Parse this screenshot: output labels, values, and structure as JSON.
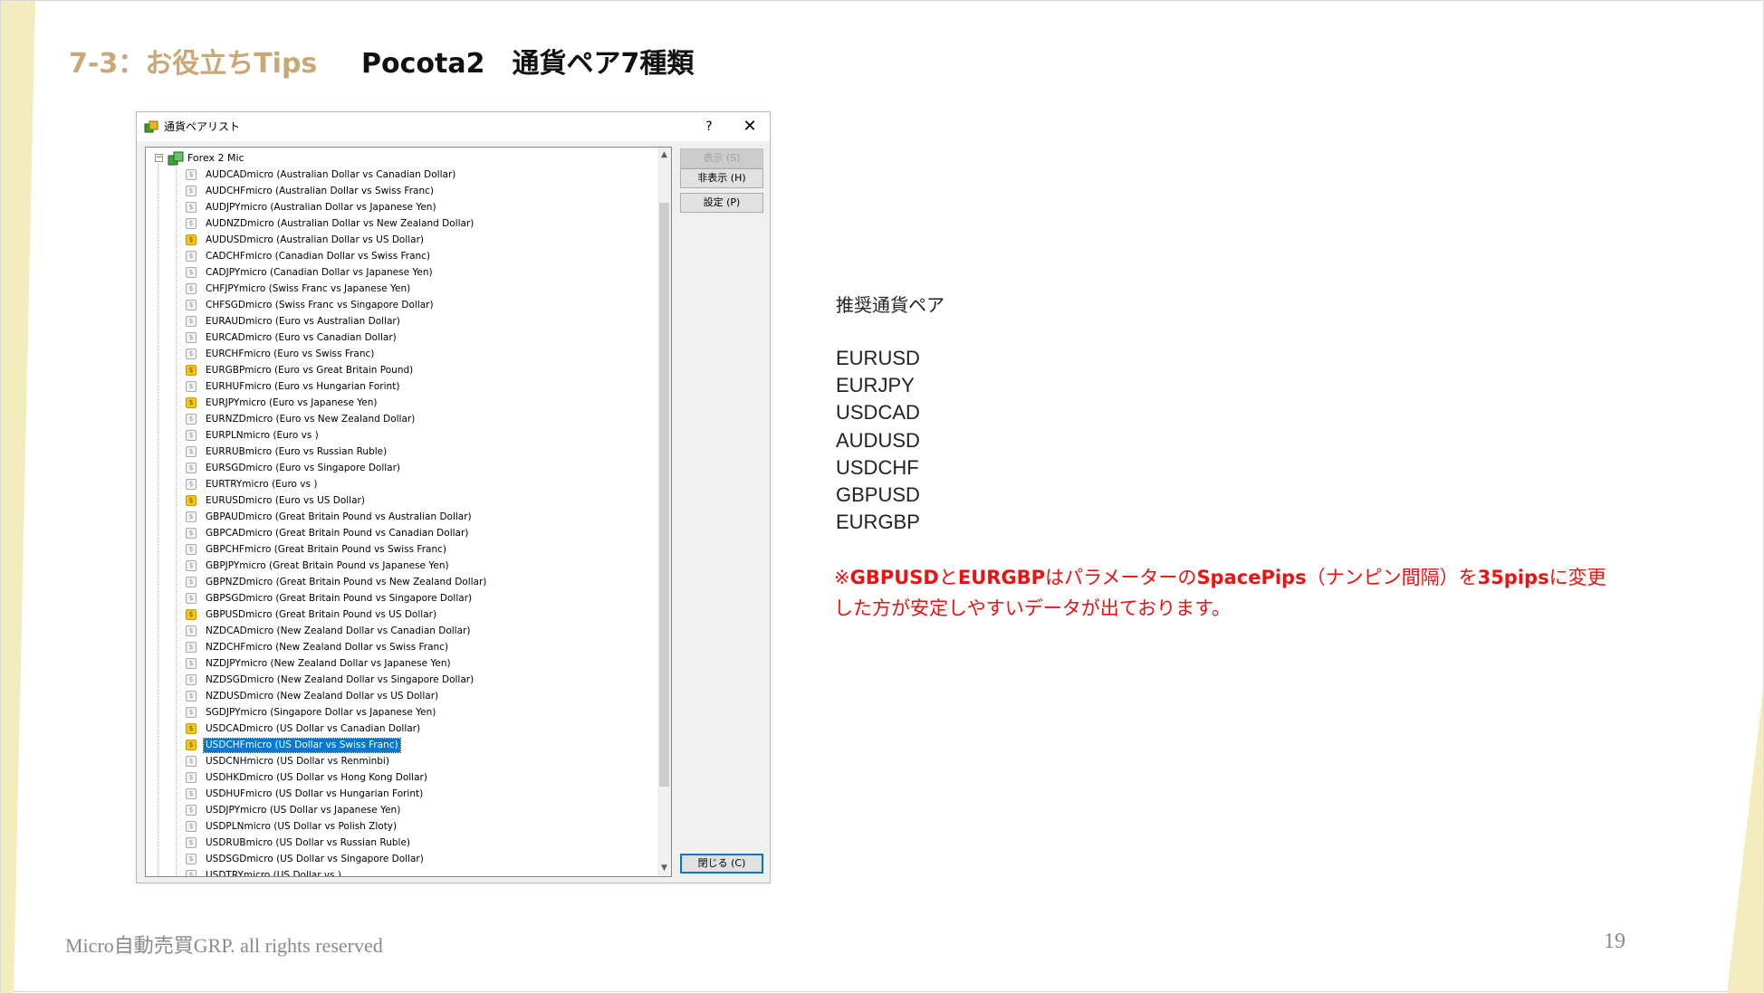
{
  "slide": {
    "section_title": "7-3：お役立ちTips",
    "main_title": "Pocota2　通貨ペア7種類",
    "footer": "Micro自動売買GRP. all rights reserved",
    "page_number": "19"
  },
  "dialog": {
    "title": "通貨ペアリスト",
    "help_label": "?",
    "close_label": "✕",
    "root_label": "Forex 2 Mic",
    "buttons": {
      "show": "表示 (S)",
      "hide": "非表示 (H)",
      "settings": "設定 (P)",
      "close": "閉じる (C)"
    },
    "items": [
      {
        "label": "AUDCADmicro  (Australian Dollar vs Canadian Dollar)",
        "active": false
      },
      {
        "label": "AUDCHFmicro  (Australian Dollar vs Swiss Franc)",
        "active": false
      },
      {
        "label": "AUDJPYmicro  (Australian Dollar vs Japanese Yen)",
        "active": false
      },
      {
        "label": "AUDNZDmicro  (Australian Dollar vs New Zealand Dollar)",
        "active": false
      },
      {
        "label": "AUDUSDmicro  (Australian Dollar vs US Dollar)",
        "active": true
      },
      {
        "label": "CADCHFmicro  (Canadian Dollar vs Swiss Franc)",
        "active": false
      },
      {
        "label": "CADJPYmicro  (Canadian Dollar vs Japanese Yen)",
        "active": false
      },
      {
        "label": "CHFJPYmicro  (Swiss Franc vs Japanese Yen)",
        "active": false
      },
      {
        "label": "CHFSGDmicro  (Swiss Franc vs Singapore Dollar)",
        "active": false
      },
      {
        "label": "EURAUDmicro  (Euro vs Australian Dollar)",
        "active": false
      },
      {
        "label": "EURCADmicro  (Euro vs Canadian Dollar)",
        "active": false
      },
      {
        "label": "EURCHFmicro  (Euro vs Swiss Franc)",
        "active": false
      },
      {
        "label": "EURGBPmicro  (Euro vs Great Britain Pound)",
        "active": true
      },
      {
        "label": "EURHUFmicro  (Euro vs Hungarian Forint)",
        "active": false
      },
      {
        "label": "EURJPYmicro  (Euro vs Japanese Yen)",
        "active": true
      },
      {
        "label": "EURNZDmicro  (Euro vs New Zealand Dollar)",
        "active": false
      },
      {
        "label": "EURPLNmicro  (Euro vs )",
        "active": false
      },
      {
        "label": "EURRUBmicro  (Euro vs Russian Ruble)",
        "active": false
      },
      {
        "label": "EURSGDmicro  (Euro vs Singapore Dollar)",
        "active": false
      },
      {
        "label": "EURTRYmicro  (Euro vs )",
        "active": false
      },
      {
        "label": "EURUSDmicro  (Euro vs US Dollar)",
        "active": true
      },
      {
        "label": "GBPAUDmicro  (Great Britain Pound vs Australian Dollar)",
        "active": false
      },
      {
        "label": "GBPCADmicro  (Great Britain Pound vs Canadian Dollar)",
        "active": false
      },
      {
        "label": "GBPCHFmicro  (Great Britain Pound vs Swiss Franc)",
        "active": false
      },
      {
        "label": "GBPJPYmicro  (Great Britain Pound vs Japanese Yen)",
        "active": false
      },
      {
        "label": "GBPNZDmicro  (Great Britain Pound vs New Zealand Dollar)",
        "active": false
      },
      {
        "label": "GBPSGDmicro  (Great Britain Pound vs Singapore Dollar)",
        "active": false
      },
      {
        "label": "GBPUSDmicro  (Great Britain Pound vs US Dollar)",
        "active": true
      },
      {
        "label": "NZDCADmicro  (New Zealand Dollar vs Canadian Dollar)",
        "active": false
      },
      {
        "label": "NZDCHFmicro  (New Zealand Dollar vs Swiss Franc)",
        "active": false
      },
      {
        "label": "NZDJPYmicro  (New Zealand Dollar vs Japanese Yen)",
        "active": false
      },
      {
        "label": "NZDSGDmicro  (New Zealand Dollar vs Singapore Dollar)",
        "active": false
      },
      {
        "label": "NZDUSDmicro  (New Zealand Dollar vs US Dollar)",
        "active": false
      },
      {
        "label": "SGDJPYmicro  (Singapore Dollar vs Japanese Yen)",
        "active": false
      },
      {
        "label": "USDCADmicro  (US Dollar vs Canadian Dollar)",
        "active": true
      },
      {
        "label": "USDCHFmicro  (US Dollar vs Swiss Franc)",
        "active": true,
        "selected": true
      },
      {
        "label": "USDCNHmicro  (US Dollar vs Renminbi)",
        "active": false
      },
      {
        "label": "USDHKDmicro  (US Dollar vs Hong Kong Dollar)",
        "active": false
      },
      {
        "label": "USDHUFmicro  (US Dollar vs Hungarian Forint)",
        "active": false
      },
      {
        "label": "USDJPYmicro  (US Dollar vs Japanese Yen)",
        "active": false
      },
      {
        "label": "USDPLNmicro  (US Dollar vs Polish Zloty)",
        "active": false
      },
      {
        "label": "USDRUBmicro  (US Dollar vs Russian Ruble)",
        "active": false
      },
      {
        "label": "USDSGDmicro  (US Dollar vs Singapore Dollar)",
        "active": false
      },
      {
        "label": "USDTRYmicro  (US Dollar vs )",
        "active": false
      }
    ]
  },
  "recommended": {
    "heading": "推奨通貨ペア",
    "pairs": [
      "EURUSD",
      "EURJPY",
      "USDCAD",
      "AUDUSD",
      "USDCHF",
      "GBPUSD",
      "EURGBP"
    ],
    "note": {
      "mark": "※",
      "pair1": "GBPUSD",
      "and": "と",
      "pair2": "EURGBP",
      "text1": "はパラメーターの",
      "param": "SpacePips",
      "text2": "（ナンピン間隔）を",
      "value": "35pips",
      "text3": "に変更した方が安定しやすいデータが出ております。"
    }
  },
  "colors": {
    "accent_gold": "#c9a877",
    "note_red": "#ee1111",
    "selection_blue": "#0078d7",
    "symbol_active": "#f5c518"
  }
}
